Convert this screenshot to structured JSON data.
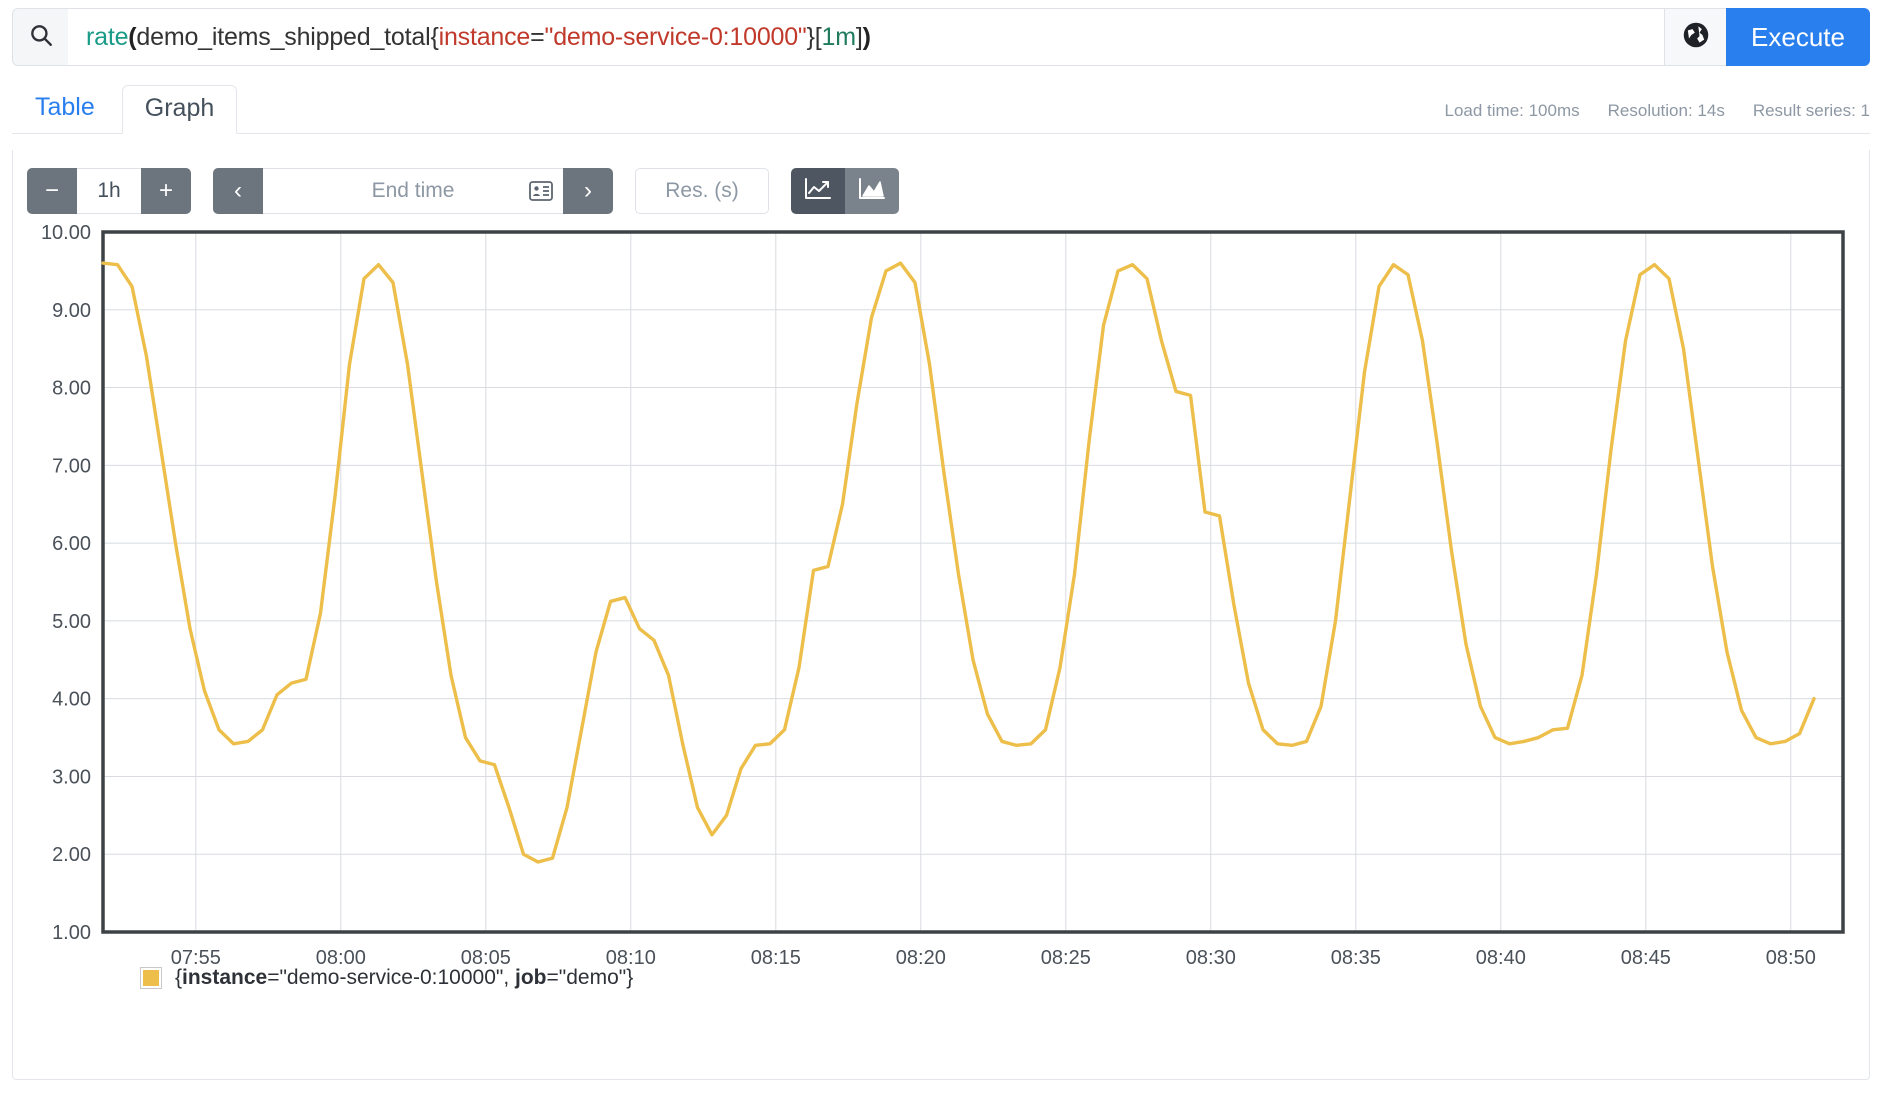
{
  "query": {
    "search_icon": "search-icon",
    "expression_full": "rate(demo_items_shipped_total{instance=\"demo-service-0:10000\"}[1m])",
    "tokens": {
      "func": "rate",
      "open_paren": "(",
      "metric": "demo_items_shipped_total",
      "open_brace": "{",
      "label_key": "instance",
      "equals": "=",
      "label_value": "\"demo-service-0:10000\"",
      "close_brace": "}",
      "open_bracket": "[",
      "duration": "1m",
      "close_bracket": "]",
      "close_paren": ")"
    },
    "globe_icon": "globe-icon",
    "execute_label": "Execute"
  },
  "tabs": [
    {
      "label": "Table",
      "active": false
    },
    {
      "label": "Graph",
      "active": true
    }
  ],
  "stats": {
    "load_time": "Load time: 100ms",
    "resolution": "Resolution: 14s",
    "result_series": "Result series: 1"
  },
  "controls": {
    "range_decrease": "−",
    "range_value": "1h",
    "range_increase": "+",
    "nav_prev": "‹",
    "nav_next": "›",
    "end_time_placeholder": "End time",
    "end_time_value": "",
    "calendar_icon": "calendar-icon",
    "resolution_placeholder": "Res. (s)",
    "resolution_value": "",
    "chart_type_line_icon": "line-chart-icon",
    "chart_type_area_icon": "area-chart-icon",
    "chart_type_selected": "line"
  },
  "legend": {
    "swatch_color": "#edbf4a",
    "series_prefix": "{",
    "label_instance_key": "instance",
    "label_instance_value": "=\"demo-service-0:10000\", ",
    "label_job_key": "job",
    "label_job_value": "=\"demo\"",
    "series_suffix": "}",
    "full_text": "{instance=\"demo-service-0:10000\", job=\"demo\"}"
  },
  "colors": {
    "series_line": "#edbf4a",
    "accent_blue": "#2a7fef",
    "grid": "#d8dce0",
    "axis": "#3d4247",
    "tick_text": "#4a5159",
    "muted_text": "#8d98a4",
    "toolbar_dark": "#6c757d",
    "toggle_active": "#4e5761"
  },
  "chart_data": {
    "type": "line",
    "title": "",
    "xlabel": "",
    "ylabel": "",
    "grid": true,
    "legend_position": "bottom-left",
    "ylim": [
      1.0,
      10.0
    ],
    "ytick_labels": [
      "10.00",
      "9.00",
      "8.00",
      "7.00",
      "6.00",
      "5.00",
      "4.00",
      "3.00",
      "2.00",
      "1.00"
    ],
    "ytick_values": [
      10,
      9,
      8,
      7,
      6,
      5,
      4,
      3,
      2,
      1
    ],
    "xtick_labels": [
      "07:55",
      "08:00",
      "08:05",
      "08:10",
      "08:15",
      "08:20",
      "08:25",
      "08:30",
      "08:35",
      "08:40",
      "08:45",
      "08:50"
    ],
    "xtick_minutes": [
      475,
      480,
      485,
      490,
      495,
      500,
      505,
      510,
      515,
      520,
      525,
      530
    ],
    "xlim_minutes": [
      471.8,
      531.8
    ],
    "series": [
      {
        "name": "{instance=\"demo-service-0:10000\", job=\"demo\"}",
        "color": "#edbf4a",
        "points_t": [
          471.8,
          472.3,
          472.8,
          473.3,
          473.8,
          474.3,
          474.8,
          475.3,
          475.8,
          476.3,
          476.8,
          477.3,
          477.8,
          478.3,
          478.8,
          479.3,
          479.8,
          480.3,
          480.8,
          481.3,
          481.8,
          482.3,
          482.8,
          483.3,
          483.8,
          484.3,
          484.8,
          485.3,
          485.8,
          486.3,
          486.8,
          487.3,
          487.8,
          488.3,
          488.8,
          489.3,
          489.8,
          490.3,
          490.8,
          491.3,
          491.8,
          492.3,
          492.8,
          493.3,
          493.8,
          494.3,
          494.8,
          495.3,
          495.8,
          496.3,
          496.8,
          497.3,
          497.8,
          498.3,
          498.8,
          499.3,
          499.8,
          500.3,
          500.8,
          501.3,
          501.8,
          502.3,
          502.8,
          503.3,
          503.8,
          504.3,
          504.8,
          505.3,
          505.8,
          506.3,
          506.8,
          507.3,
          507.8,
          508.3,
          508.8,
          509.3,
          509.8,
          510.3,
          510.8,
          511.3,
          511.8,
          512.3,
          512.8,
          513.3,
          513.8,
          514.3,
          514.8,
          515.3,
          515.8,
          516.3,
          516.8,
          517.3,
          517.8,
          518.3,
          518.8,
          519.3,
          519.8,
          520.3,
          520.8,
          521.3,
          521.8,
          522.3,
          522.8,
          523.3,
          523.8,
          524.3,
          524.8,
          525.3,
          525.8,
          526.3,
          526.8,
          527.3,
          527.8,
          528.3,
          528.8,
          529.3,
          529.8,
          530.3,
          530.8,
          531.3,
          531.8
        ],
        "points_v": [
          9.6,
          9.58,
          9.3,
          8.4,
          7.2,
          6.0,
          4.9,
          4.1,
          3.6,
          3.42,
          3.45,
          3.6,
          4.05,
          4.2,
          4.25,
          5.1,
          6.6,
          8.3,
          9.4,
          9.58,
          9.35,
          8.3,
          6.9,
          5.5,
          4.3,
          3.5,
          3.2,
          3.15,
          2.6,
          2.0,
          1.9,
          1.95,
          2.6,
          3.6,
          4.6,
          5.25,
          5.3,
          4.9,
          4.75,
          4.3,
          3.4,
          2.6,
          2.25,
          2.5,
          3.1,
          3.4,
          3.42,
          3.6,
          4.4,
          5.65,
          5.7,
          6.5,
          7.8,
          8.9,
          9.5,
          9.6,
          9.35,
          8.3,
          6.9,
          5.6,
          4.5,
          3.8,
          3.45,
          3.4,
          3.42,
          3.6,
          4.4,
          5.6,
          7.3,
          8.8,
          9.5,
          9.58,
          9.4,
          8.6,
          7.95,
          7.9,
          6.4,
          6.35,
          5.2,
          4.2,
          3.6,
          3.42,
          3.4,
          3.45,
          3.9,
          5.0,
          6.6,
          8.2,
          9.3,
          9.58,
          9.45,
          8.6,
          7.3,
          5.9,
          4.7,
          3.9,
          3.5,
          3.42,
          3.45,
          3.5,
          3.6,
          3.62,
          4.3,
          5.6,
          7.2,
          8.6,
          9.45,
          9.58,
          9.4,
          8.5,
          7.1,
          5.7,
          4.6,
          3.85,
          3.5,
          3.42,
          3.45,
          3.55,
          4.0
        ],
        "description": "Periodic sawtooth-like oscillation between roughly 1.9 and 9.6, repeating with a main peak about every 5 minutes and a deeper valley pattern every ~20 minutes."
      }
    ]
  }
}
